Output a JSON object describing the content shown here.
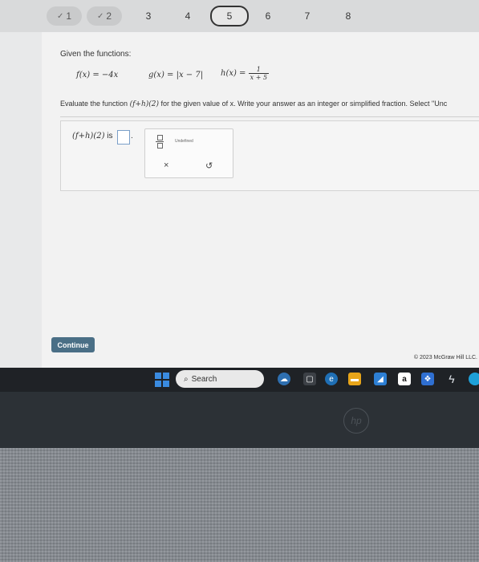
{
  "progress": {
    "steps": [
      {
        "label": "1",
        "status": "done"
      },
      {
        "label": "2",
        "status": "done"
      },
      {
        "label": "3",
        "status": "todo"
      },
      {
        "label": "4",
        "status": "todo"
      },
      {
        "label": "5",
        "status": "current"
      },
      {
        "label": "6",
        "status": "todo"
      },
      {
        "label": "7",
        "status": "todo"
      },
      {
        "label": "8",
        "status": "todo"
      }
    ]
  },
  "question": {
    "intro": "Given the functions:",
    "f_def": "f(x) = −4x",
    "g_def": "g(x) = |x − 7|",
    "h_lhs": "h(x) =",
    "h_num": "1",
    "h_den": "x + 5",
    "instruction_prefix": "Evaluate the function ",
    "instruction_expr": "(f+h)(2)",
    "instruction_suffix": " for the given value of x. Write your answer as an integer or simplified fraction. Select \"Unc",
    "answer_label_expr": "(f+h)(2)",
    "answer_label_suffix": " is",
    "answer_value": "",
    "answer_trailing": "."
  },
  "keypad": {
    "undefined_label": "Undefined",
    "clear_symbol": "×",
    "undo_symbol": "↺"
  },
  "footer": {
    "continue_label": "Continue",
    "copyright": "© 2023 McGraw Hill LLC."
  },
  "taskbar": {
    "search_placeholder": "Search",
    "amazon_label": "a"
  },
  "device": {
    "logo": "hp"
  },
  "colors": {
    "continue_bg": "#4a6f86",
    "taskbar_bg": "#1f2226",
    "windows_blue": "#3a8be0"
  }
}
